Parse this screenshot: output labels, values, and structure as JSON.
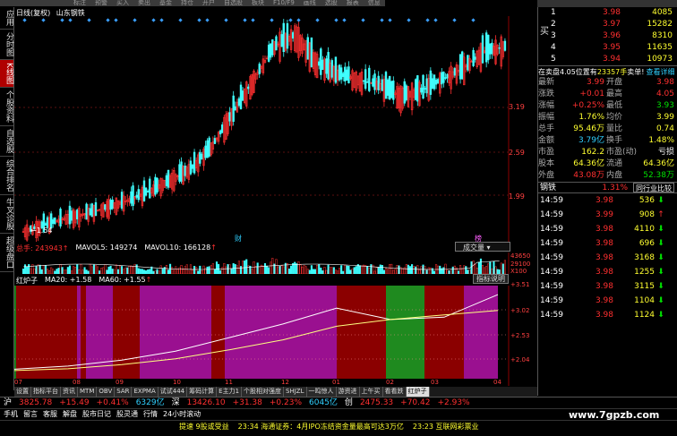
{
  "menubar": [
    "标注",
    "预警",
    "买入",
    "卖出",
    "基金",
    "持仓",
    "开户",
    "自选股",
    "板块",
    "F10/F9",
    "画线",
    "选股",
    "报表",
    "信息"
  ],
  "left_tabs": [
    {
      "label": "应用",
      "active": false
    },
    {
      "label": "分时图",
      "active": false
    },
    {
      "label": "K线图",
      "active": true
    },
    {
      "label": "个股资料",
      "active": false
    },
    {
      "label": "自选股",
      "active": false
    },
    {
      "label": "综合排名",
      "active": false
    },
    {
      "label": "牛叉诊股",
      "active": false
    },
    {
      "label": "超级盘口",
      "active": false
    }
  ],
  "chart": {
    "period_label": "日线(复权)",
    "stock_name": "山东钢铁",
    "min_label": "1.54",
    "price_axis": [
      "3.19",
      "2.59",
      "1.99"
    ],
    "event_markers": [
      "财",
      "榜"
    ],
    "volume": {
      "label": "总手",
      "value": "243943",
      "ma5": "MAVOL5: 149274",
      "ma10": "MAVOL10: 166128",
      "dropdown": "成交量",
      "axis": [
        "43650",
        "29100",
        "14550",
        "X100"
      ]
    },
    "indicator": {
      "name": "红炉子",
      "ma20": "MA20: +1.58",
      "ma60": "MA60: +1.55",
      "help_button": "指标说明",
      "axis": [
        "+3.51",
        "+3.02",
        "+2.53",
        "+2.04"
      ]
    },
    "months": [
      "07",
      "08",
      "09",
      "10",
      "11",
      "12",
      "01",
      "02",
      "03",
      "04"
    ]
  },
  "chart_data": {
    "type": "line",
    "title": "山东钢铁 日线(复权)",
    "xlabel": "",
    "ylabel": "",
    "x": [
      "07",
      "08",
      "09",
      "10",
      "11",
      "12",
      "01",
      "02",
      "03",
      "04"
    ],
    "series": [
      {
        "name": "MA20",
        "values": [
          1.75,
          1.82,
          1.95,
          2.15,
          2.45,
          2.75,
          3.1,
          2.85,
          2.9,
          3.4
        ]
      },
      {
        "name": "MA60",
        "values": [
          1.72,
          1.76,
          1.85,
          1.98,
          2.18,
          2.4,
          2.7,
          2.85,
          2.95,
          3.05
        ]
      }
    ],
    "ylim": [
      1.54,
      3.6
    ],
    "price_close": [
      1.54,
      1.6,
      1.66,
      1.7,
      1.76,
      1.82,
      1.9,
      2.0,
      2.1,
      2.3,
      2.6,
      2.9,
      3.2,
      3.3,
      3.05,
      2.95,
      2.9,
      2.85,
      2.75,
      2.8,
      2.9,
      3.0,
      3.15,
      3.19
    ]
  },
  "bottom_tabs": [
    {
      "label": "设置",
      "active": false
    },
    {
      "label": "指标平台",
      "active": false
    },
    {
      "label": "资讯",
      "active": false
    },
    {
      "label": "MTM",
      "active": false
    },
    {
      "label": "OBV",
      "active": false
    },
    {
      "label": "SAR",
      "active": false
    },
    {
      "label": "EXPMA",
      "active": false
    },
    {
      "label": "试试444",
      "active": false
    },
    {
      "label": "筹码计算",
      "active": false
    },
    {
      "label": "E主力1",
      "active": false
    },
    {
      "label": "个股相对强度",
      "active": false
    },
    {
      "label": "SHJZL",
      "active": false
    },
    {
      "label": "一鸣惊人",
      "active": false
    },
    {
      "label": "游资进",
      "active": false
    },
    {
      "label": "上午买",
      "active": false
    },
    {
      "label": "看看跌",
      "active": false
    },
    {
      "label": "红炉子",
      "active": true
    }
  ],
  "quote": {
    "sell_label": "卖",
    "buy_label": "买",
    "asks": [
      {
        "lvl": "5",
        "price": "4.03",
        "vol": "7987"
      },
      {
        "lvl": "4",
        "price": "4.02",
        "vol": "11870"
      },
      {
        "lvl": "3",
        "price": "4.01",
        "vol": "7860"
      },
      {
        "lvl": "2",
        "price": "4.00",
        "vol": "12034"
      },
      {
        "lvl": "1",
        "price": "3.99",
        "vol": "3412"
      }
    ],
    "bids": [
      {
        "lvl": "1",
        "price": "3.98",
        "vol": "4085"
      },
      {
        "lvl": "2",
        "price": "3.97",
        "vol": "15282"
      },
      {
        "lvl": "3",
        "price": "3.96",
        "vol": "8310"
      },
      {
        "lvl": "4",
        "price": "3.95",
        "vol": "11635"
      },
      {
        "lvl": "5",
        "price": "3.94",
        "vol": "10973"
      }
    ],
    "position_line": "在卖盘4.05位置有",
    "position_vol": "23357手",
    "position_suffix": "卖单!",
    "view_detail": "查看详细",
    "stats": [
      {
        "k1": "最新",
        "v1": "3.99",
        "c1": "red",
        "k2": "开盘",
        "v2": "3.98",
        "c2": "red"
      },
      {
        "k1": "涨跌",
        "v1": "+0.01",
        "c1": "red",
        "k2": "最高",
        "v2": "4.05",
        "c2": "red"
      },
      {
        "k1": "涨幅",
        "v1": "+0.25%",
        "c1": "red",
        "k2": "最低",
        "v2": "3.93",
        "c2": "green"
      },
      {
        "k1": "振幅",
        "v1": "1.76%",
        "c1": "yellow",
        "k2": "均价",
        "v2": "3.99",
        "c2": "yellow"
      },
      {
        "k1": "总手",
        "v1": "95.46万",
        "c1": "yellow",
        "k2": "量比",
        "v2": "0.74",
        "c2": "yellow"
      },
      {
        "k1": "金额",
        "v1": "3.79亿",
        "c1": "cyan",
        "k2": "换手",
        "v2": "1.48%",
        "c2": "yellow"
      },
      {
        "k1": "市盈",
        "v1": "162.2",
        "c1": "yellow",
        "k2": "市盈(动)",
        "v2": "亏损",
        "c2": "white"
      },
      {
        "k1": "股本",
        "v1": "64.36亿",
        "c1": "yellow",
        "k2": "流通",
        "v2": "64.36亿",
        "c2": "yellow"
      },
      {
        "k1": "外盘",
        "v1": "43.08万",
        "c1": "red",
        "k2": "内盘",
        "v2": "52.38万",
        "c2": "green"
      }
    ],
    "sector_name": "钢铁",
    "sector_pct": "1.31%",
    "compare_btn": "同行业比较",
    "ticks": [
      {
        "t": "14:59",
        "p": "3.98",
        "v": "536",
        "d": "down"
      },
      {
        "t": "14:59",
        "p": "3.99",
        "v": "908",
        "d": "up"
      },
      {
        "t": "14:59",
        "p": "3.98",
        "v": "4110",
        "d": "down"
      },
      {
        "t": "14:59",
        "p": "3.98",
        "v": "696",
        "d": "down"
      },
      {
        "t": "14:59",
        "p": "3.98",
        "v": "3168",
        "d": "down"
      },
      {
        "t": "14:59",
        "p": "3.98",
        "v": "1255",
        "d": "down"
      },
      {
        "t": "14:59",
        "p": "3.98",
        "v": "3115",
        "d": "down"
      },
      {
        "t": "14:59",
        "p": "3.98",
        "v": "1104",
        "d": "down"
      },
      {
        "t": "14:59",
        "p": "3.98",
        "v": "1124",
        "d": "down"
      }
    ]
  },
  "ticker": {
    "row1": [
      {
        "text": "沪",
        "c": "white"
      },
      {
        "text": "3825.78",
        "c": "red"
      },
      {
        "text": "+15.49",
        "c": "red"
      },
      {
        "text": "+0.41%",
        "c": "red"
      },
      {
        "text": "6329亿",
        "c": "cyan"
      },
      {
        "text": "深",
        "c": "white"
      },
      {
        "text": "13426.10",
        "c": "red"
      },
      {
        "text": "+31.38",
        "c": "red"
      },
      {
        "text": "+0.23%",
        "c": "red"
      },
      {
        "text": "6045亿",
        "c": "cyan"
      },
      {
        "text": "创",
        "c": "white"
      },
      {
        "text": "2475.33",
        "c": "red"
      },
      {
        "text": "+70.42",
        "c": "red"
      },
      {
        "text": "+2.93%",
        "c": "red"
      }
    ],
    "row2": [
      "手机",
      "留言",
      "客服",
      "解盘",
      "股市日记",
      "股灵通",
      "行情",
      "24小时滚动"
    ],
    "news": [
      "提速 9股或受益",
      "23:34 海通证券：4月IPO冻结资金量最高可达3万亿",
      "23:23 互联网彩票业"
    ],
    "watermark": "www.7gpzb.com"
  }
}
